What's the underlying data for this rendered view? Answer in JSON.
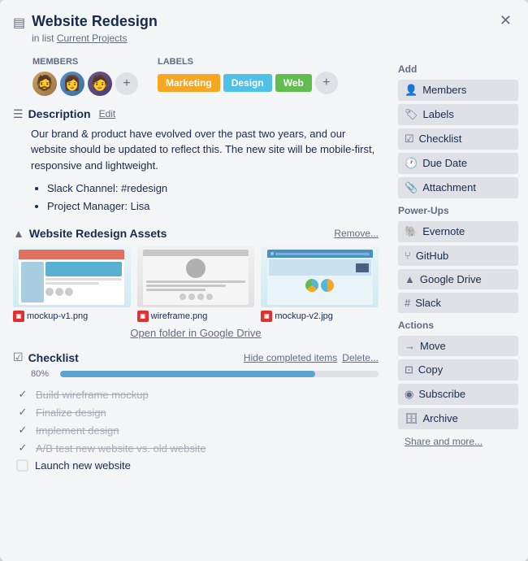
{
  "card": {
    "icon": "▤",
    "title": "Website Redesign",
    "list_prefix": "in list",
    "list_name": "Current Projects"
  },
  "members": {
    "label": "Members",
    "avatars": [
      {
        "id": 1,
        "initials": "A",
        "color_class": "avatar-1"
      },
      {
        "id": 2,
        "initials": "B",
        "color_class": "avatar-2"
      },
      {
        "id": 3,
        "initials": "C",
        "color_class": "avatar-3"
      }
    ],
    "add_button": "+"
  },
  "labels_section": {
    "label": "Labels",
    "tags": [
      {
        "text": "Marketing",
        "css_class": "label-marketing"
      },
      {
        "text": "Design",
        "css_class": "label-design"
      },
      {
        "text": "Web",
        "css_class": "label-web"
      }
    ],
    "add_button": "+"
  },
  "description": {
    "title": "Description",
    "edit_label": "Edit",
    "text": "Our brand & product have evolved over the past two years, and our website should be updated to reflect this. The new site will be mobile-first, responsive and lightweight.",
    "list_items": [
      "Slack Channel: #redesign",
      "Project Manager: Lisa"
    ]
  },
  "assets": {
    "title": "Website Redesign Assets",
    "remove_label": "Remove...",
    "files": [
      {
        "name": "mockup-v1.png"
      },
      {
        "name": "wireframe.png"
      },
      {
        "name": "mockup-v2.jpg"
      }
    ],
    "open_folder_label": "Open folder in Google Drive"
  },
  "checklist": {
    "title": "Checklist",
    "hide_label": "Hide completed items",
    "delete_label": "Delete...",
    "progress_pct": "80%",
    "progress_value": 80,
    "items": [
      {
        "text": "Build wireframe mockup",
        "done": true
      },
      {
        "text": "Finalize design",
        "done": true
      },
      {
        "text": "Implement design",
        "done": true
      },
      {
        "text": "A/B test new website vs. old website",
        "done": true
      },
      {
        "text": "Launch new website",
        "done": false
      }
    ]
  },
  "sidebar": {
    "add_section_title": "Add",
    "add_buttons": [
      {
        "icon": "👤",
        "label": "Members",
        "name": "members-add-button"
      },
      {
        "icon": "🏷",
        "label": "Labels",
        "name": "labels-add-button"
      },
      {
        "icon": "☑",
        "label": "Checklist",
        "name": "checklist-add-button"
      },
      {
        "icon": "🕐",
        "label": "Due Date",
        "name": "due-date-button"
      },
      {
        "icon": "📎",
        "label": "Attachment",
        "name": "attachment-button"
      }
    ],
    "powerups_section_title": "Power-Ups",
    "powerup_buttons": [
      {
        "icon": "🐘",
        "label": "Evernote",
        "name": "evernote-button"
      },
      {
        "icon": "⑂",
        "label": "GitHub",
        "name": "github-button"
      },
      {
        "icon": "▲",
        "label": "Google Drive",
        "name": "google-drive-button"
      },
      {
        "icon": "#",
        "label": "Slack",
        "name": "slack-button"
      }
    ],
    "actions_section_title": "Actions",
    "action_buttons": [
      {
        "icon": "→",
        "label": "Move",
        "name": "move-button"
      },
      {
        "icon": "⊡",
        "label": "Copy",
        "name": "copy-button"
      },
      {
        "icon": "◉",
        "label": "Subscribe",
        "name": "subscribe-button"
      },
      {
        "icon": "🗄",
        "label": "Archive",
        "name": "archive-button"
      }
    ],
    "share_label": "Share and more..."
  }
}
